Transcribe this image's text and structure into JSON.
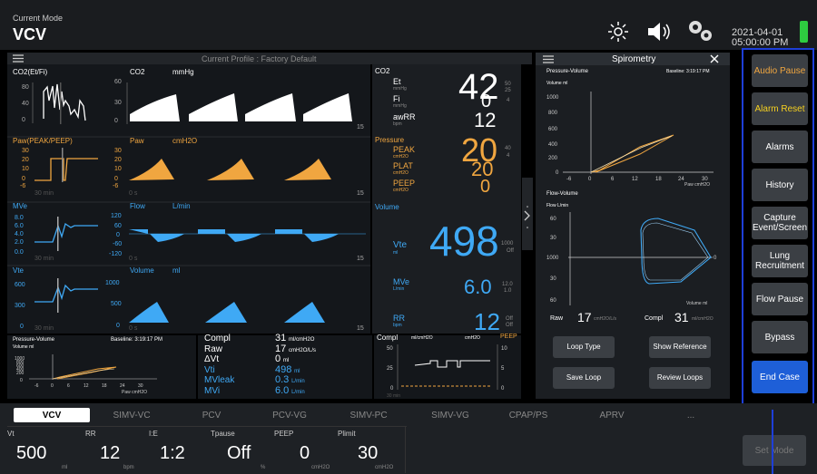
{
  "header": {
    "mode_caption": "Current Mode",
    "mode": "VCV",
    "date": "2021-04-01",
    "time": "05:00:00 PM"
  },
  "profile": "Current Profile : Factory Default",
  "waves": {
    "co2efi": {
      "label": "CO2(Et/Fi)",
      "ticks": [
        "80",
        "40",
        "0"
      ]
    },
    "co2": {
      "label": "CO2",
      "unit": "mmHg",
      "ticks": [
        "60",
        "30",
        "0"
      ],
      "foot": "15"
    },
    "pawpp": {
      "label": "Paw(PEAK/PEEP)",
      "ticks": [
        "30",
        "20",
        "10",
        "0",
        "-6"
      ],
      "foot": "30 min"
    },
    "paw": {
      "label": "Paw",
      "unit": "cmH2O",
      "ticks": [
        "30",
        "20",
        "10",
        "0",
        "-6"
      ],
      "foot": "15",
      "start": "0 s"
    },
    "mve": {
      "label": "MVe",
      "ticks": [
        "8.0",
        "6.0",
        "4.0",
        "2.0",
        "0.0"
      ],
      "foot": "30 min"
    },
    "flow": {
      "label": "Flow",
      "unit": "L/min",
      "ticks": [
        "120",
        "60",
        "0",
        "-60",
        "-120"
      ],
      "foot": "15",
      "start": "0 s"
    },
    "vte": {
      "label": "Vte",
      "ticks": [
        "600",
        "300",
        "0"
      ],
      "foot": "30 min"
    },
    "volume": {
      "label": "Volume",
      "unit": "ml",
      "ticks": [
        "1000",
        "500",
        "0"
      ],
      "foot": "15",
      "start": "0 s"
    }
  },
  "numerics": {
    "co2": {
      "label": "CO2",
      "et_label": "Et",
      "et_unit": "mmHg",
      "et": "42",
      "et_hi": "50",
      "et_lo": "25",
      "fi_label": "Fi",
      "fi_unit": "mmHg",
      "fi": "0",
      "fi_hi": "4",
      "awrr_label": "awRR",
      "awrr_unit": "bpm",
      "awrr": "12"
    },
    "pressure": {
      "label": "Pressure",
      "peak_label": "PEAK",
      "peak_unit": "cmH2O",
      "peak": "20",
      "peak_hi": "40",
      "peak_lo": "4",
      "plat_label": "PLAT",
      "plat_unit": "cmH2O",
      "plat": "20",
      "peep_label": "PEEP",
      "peep_unit": "cmH2O",
      "peep": "0"
    },
    "volume": {
      "label": "Volume",
      "vte_label": "Vte",
      "vte_unit": "ml",
      "vte": "498",
      "vte_hi": "1000",
      "vte_lo": "Off"
    },
    "mve": {
      "label": "MVe",
      "unit": "L/min",
      "value": "6.0",
      "hi": "12.0",
      "lo": "1.0"
    },
    "rr": {
      "label": "RR",
      "unit": "bpm",
      "value": "12",
      "hi": "Off",
      "lo": "Off"
    }
  },
  "mini_loop": {
    "title": "Pressure-Volume",
    "baseline": "Baseline: 3:19:17 PM",
    "ylabel": "Volume ml",
    "yticks": [
      "1000",
      "800",
      "600",
      "400",
      "200",
      "0"
    ],
    "xticks": [
      "-6",
      "0",
      "6",
      "12",
      "18",
      "24",
      "30"
    ],
    "xunit": "Paw cmH2O"
  },
  "mech": {
    "rows": [
      {
        "label": "Compl",
        "value": "31",
        "unit": "ml/cmH2O"
      },
      {
        "label": "Raw",
        "value": "17",
        "unit": "cmH2O/L/s"
      },
      {
        "label": "ΔVt",
        "value": "0",
        "unit": "ml"
      },
      {
        "label": "Vti",
        "value": "498",
        "unit": "ml"
      },
      {
        "label": "MVleak",
        "value": "0.3",
        "unit": "L/min"
      },
      {
        "label": "MVi",
        "value": "6.0",
        "unit": "L/min"
      }
    ]
  },
  "trend": {
    "title": "Compl",
    "unit": "ml/cmH2O",
    "unit2": "cmH2O",
    "peep": "PEEP",
    "yticks": [
      "50",
      "25",
      "0"
    ],
    "rticks": [
      "10",
      "5",
      "0"
    ],
    "foot": "30 min"
  },
  "spiro": {
    "title": "Spirometry",
    "pv": {
      "title": "Pressure-Volume",
      "baseline": "Baseline: 3:19:17 PM",
      "ylabel": "Volume ml",
      "yticks": [
        "1000",
        "800",
        "600",
        "400",
        "200",
        "0"
      ],
      "xticks": [
        "-6",
        "0",
        "6",
        "12",
        "18",
        "24",
        "30"
      ],
      "xunit": "Paw cmH2O"
    },
    "fv": {
      "title": "Flow-Volume",
      "ylabel": "Flow L/min",
      "yticks": [
        "60",
        "30",
        "1000",
        "30",
        "60"
      ],
      "xunit": "Volume ml",
      "zero": "0"
    },
    "raw_label": "Raw",
    "raw_value": "17",
    "raw_unit": "cmH2O/L/s",
    "compl_label": "Compl",
    "compl_value": "31",
    "compl_unit": "ml/cmH2O",
    "buttons": [
      "Loop Type",
      "Show Reference",
      "Save Loop",
      "Review Loops"
    ]
  },
  "side_buttons": [
    "Audio Pause",
    "Alarm Reset",
    "Alarms",
    "History",
    "Capture Event/Screen",
    "Lung Recruitment",
    "Flow Pause",
    "Bypass",
    "End Case"
  ],
  "tabs": [
    "VCV",
    "SIMV-VC",
    "PCV",
    "PCV-VG",
    "SIMV-PC",
    "SIMV-VG",
    "CPAP/PS",
    "APRV",
    "..."
  ],
  "settings": [
    {
      "label": "Vt",
      "value": "500",
      "unit": "ml"
    },
    {
      "label": "RR",
      "value": "12",
      "unit": "bpm"
    },
    {
      "label": "I:E",
      "value": "1:2",
      "unit": ""
    },
    {
      "label": "Tpause",
      "value": "Off",
      "unit": "%"
    },
    {
      "label": "PEEP",
      "value": "0",
      "unit": "cmH2O"
    },
    {
      "label": "Plimit",
      "value": "30",
      "unit": "cmH2O"
    }
  ],
  "set_mode": "Set Mode",
  "colors": {
    "orange": "#f0a640",
    "blue": "#3fa9f5",
    "yellow": "#f5d020",
    "select": "#1e5fd8"
  }
}
